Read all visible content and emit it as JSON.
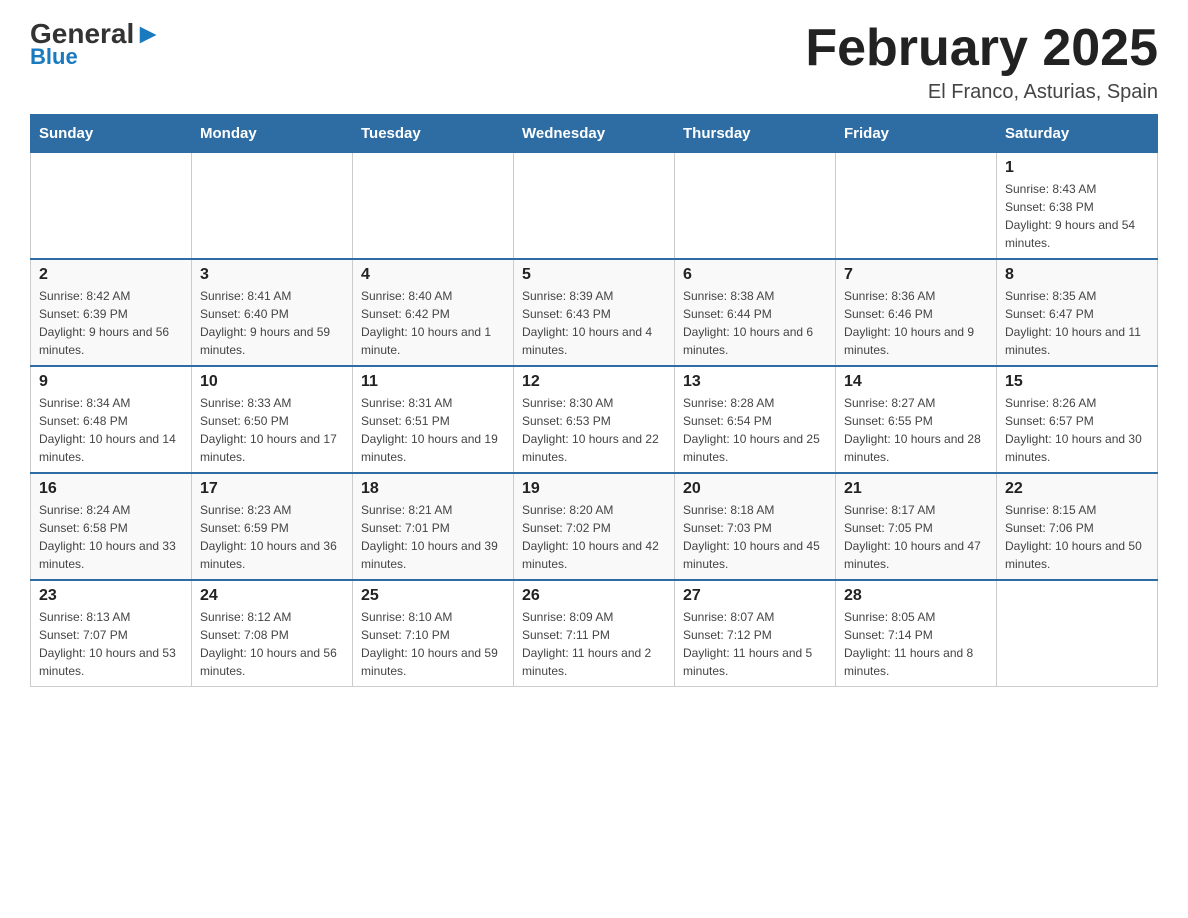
{
  "header": {
    "logo_text": "General",
    "logo_blue": "Blue",
    "title": "February 2025",
    "subtitle": "El Franco, Asturias, Spain"
  },
  "days_of_week": [
    "Sunday",
    "Monday",
    "Tuesday",
    "Wednesday",
    "Thursday",
    "Friday",
    "Saturday"
  ],
  "weeks": [
    [
      {
        "day": "",
        "info": ""
      },
      {
        "day": "",
        "info": ""
      },
      {
        "day": "",
        "info": ""
      },
      {
        "day": "",
        "info": ""
      },
      {
        "day": "",
        "info": ""
      },
      {
        "day": "",
        "info": ""
      },
      {
        "day": "1",
        "info": "Sunrise: 8:43 AM\nSunset: 6:38 PM\nDaylight: 9 hours and 54 minutes."
      }
    ],
    [
      {
        "day": "2",
        "info": "Sunrise: 8:42 AM\nSunset: 6:39 PM\nDaylight: 9 hours and 56 minutes."
      },
      {
        "day": "3",
        "info": "Sunrise: 8:41 AM\nSunset: 6:40 PM\nDaylight: 9 hours and 59 minutes."
      },
      {
        "day": "4",
        "info": "Sunrise: 8:40 AM\nSunset: 6:42 PM\nDaylight: 10 hours and 1 minute."
      },
      {
        "day": "5",
        "info": "Sunrise: 8:39 AM\nSunset: 6:43 PM\nDaylight: 10 hours and 4 minutes."
      },
      {
        "day": "6",
        "info": "Sunrise: 8:38 AM\nSunset: 6:44 PM\nDaylight: 10 hours and 6 minutes."
      },
      {
        "day": "7",
        "info": "Sunrise: 8:36 AM\nSunset: 6:46 PM\nDaylight: 10 hours and 9 minutes."
      },
      {
        "day": "8",
        "info": "Sunrise: 8:35 AM\nSunset: 6:47 PM\nDaylight: 10 hours and 11 minutes."
      }
    ],
    [
      {
        "day": "9",
        "info": "Sunrise: 8:34 AM\nSunset: 6:48 PM\nDaylight: 10 hours and 14 minutes."
      },
      {
        "day": "10",
        "info": "Sunrise: 8:33 AM\nSunset: 6:50 PM\nDaylight: 10 hours and 17 minutes."
      },
      {
        "day": "11",
        "info": "Sunrise: 8:31 AM\nSunset: 6:51 PM\nDaylight: 10 hours and 19 minutes."
      },
      {
        "day": "12",
        "info": "Sunrise: 8:30 AM\nSunset: 6:53 PM\nDaylight: 10 hours and 22 minutes."
      },
      {
        "day": "13",
        "info": "Sunrise: 8:28 AM\nSunset: 6:54 PM\nDaylight: 10 hours and 25 minutes."
      },
      {
        "day": "14",
        "info": "Sunrise: 8:27 AM\nSunset: 6:55 PM\nDaylight: 10 hours and 28 minutes."
      },
      {
        "day": "15",
        "info": "Sunrise: 8:26 AM\nSunset: 6:57 PM\nDaylight: 10 hours and 30 minutes."
      }
    ],
    [
      {
        "day": "16",
        "info": "Sunrise: 8:24 AM\nSunset: 6:58 PM\nDaylight: 10 hours and 33 minutes."
      },
      {
        "day": "17",
        "info": "Sunrise: 8:23 AM\nSunset: 6:59 PM\nDaylight: 10 hours and 36 minutes."
      },
      {
        "day": "18",
        "info": "Sunrise: 8:21 AM\nSunset: 7:01 PM\nDaylight: 10 hours and 39 minutes."
      },
      {
        "day": "19",
        "info": "Sunrise: 8:20 AM\nSunset: 7:02 PM\nDaylight: 10 hours and 42 minutes."
      },
      {
        "day": "20",
        "info": "Sunrise: 8:18 AM\nSunset: 7:03 PM\nDaylight: 10 hours and 45 minutes."
      },
      {
        "day": "21",
        "info": "Sunrise: 8:17 AM\nSunset: 7:05 PM\nDaylight: 10 hours and 47 minutes."
      },
      {
        "day": "22",
        "info": "Sunrise: 8:15 AM\nSunset: 7:06 PM\nDaylight: 10 hours and 50 minutes."
      }
    ],
    [
      {
        "day": "23",
        "info": "Sunrise: 8:13 AM\nSunset: 7:07 PM\nDaylight: 10 hours and 53 minutes."
      },
      {
        "day": "24",
        "info": "Sunrise: 8:12 AM\nSunset: 7:08 PM\nDaylight: 10 hours and 56 minutes."
      },
      {
        "day": "25",
        "info": "Sunrise: 8:10 AM\nSunset: 7:10 PM\nDaylight: 10 hours and 59 minutes."
      },
      {
        "day": "26",
        "info": "Sunrise: 8:09 AM\nSunset: 7:11 PM\nDaylight: 11 hours and 2 minutes."
      },
      {
        "day": "27",
        "info": "Sunrise: 8:07 AM\nSunset: 7:12 PM\nDaylight: 11 hours and 5 minutes."
      },
      {
        "day": "28",
        "info": "Sunrise: 8:05 AM\nSunset: 7:14 PM\nDaylight: 11 hours and 8 minutes."
      },
      {
        "day": "",
        "info": ""
      }
    ]
  ]
}
